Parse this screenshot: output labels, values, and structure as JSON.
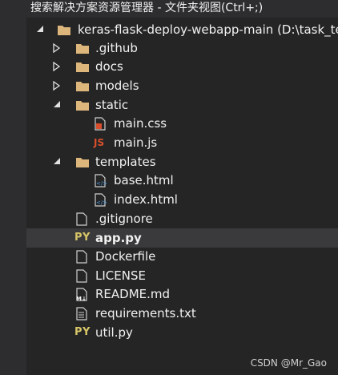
{
  "window": {
    "title": "搜索解决方案资源管理器 - 文件夹视图(Ctrl+;)"
  },
  "tree": {
    "root": "keras-flask-deploy-webapp-main (D:\\task_tea",
    "github": ".github",
    "docs": "docs",
    "models": "models",
    "static": "static",
    "main_css": "main.css",
    "main_js": "main.js",
    "templates": "templates",
    "base_html": "base.html",
    "index_html": "index.html",
    "gitignore": ".gitignore",
    "app_py": "app.py",
    "dockerfile": "Dockerfile",
    "license": "LICENSE",
    "readme": "README.md",
    "requirements": "requirements.txt",
    "util_py": "util.py"
  },
  "badges": {
    "python": "PY",
    "javascript": "JS"
  },
  "icons": {
    "folder": "folder-icon",
    "css": "css-file-icon",
    "html": "html-file-icon",
    "text": "text-file-icon",
    "markdown": "markdown-file-icon",
    "expanded": "expanded-arrow-icon",
    "collapsed": "collapsed-arrow-icon"
  },
  "colors": {
    "background": "#252526",
    "selected_row": "#3a3a3c",
    "folder": "#dcb67a",
    "python_badge": "#d8c567",
    "js_badge": "#d94f2b",
    "text": "#f1f1f1"
  },
  "watermark": "CSDN @Mr_Gao"
}
